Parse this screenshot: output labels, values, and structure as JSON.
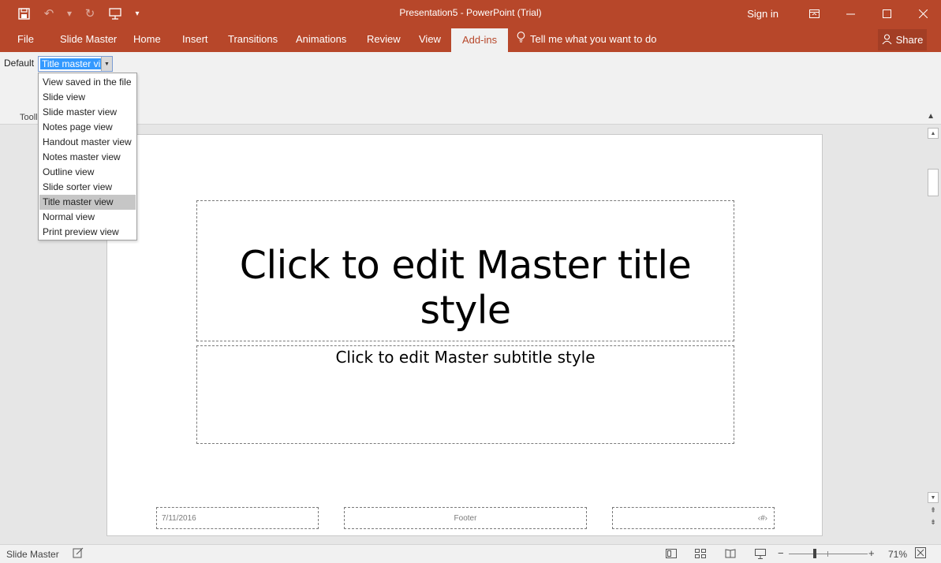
{
  "window": {
    "title": "Presentation5 - PowerPoint (Trial)",
    "sign_in": "Sign in",
    "share": "Share"
  },
  "qat": {
    "save_icon": "save-icon",
    "undo_icon": "undo-icon",
    "redo_icon": "redo-icon",
    "present_icon": "start-from-beginning-icon",
    "customize_icon": "customize-qat-icon"
  },
  "tabs": [
    {
      "label": "File"
    },
    {
      "label": "Slide Master"
    },
    {
      "label": "Home"
    },
    {
      "label": "Insert"
    },
    {
      "label": "Transitions"
    },
    {
      "label": "Animations"
    },
    {
      "label": "Review"
    },
    {
      "label": "View"
    },
    {
      "label": "Add-ins"
    }
  ],
  "active_tab": "Add-ins",
  "tell_me": "Tell me what you want to do",
  "ribbon": {
    "default_label": "Default",
    "combo_value": "Title master vi",
    "group_label": "Tooll"
  },
  "dropdown": {
    "items": [
      "View saved in the file",
      "Slide view",
      "Slide master view",
      "Notes page view",
      "Handout master view",
      "Notes master view",
      "Outline view",
      "Slide sorter view",
      "Title master view",
      "Normal view",
      "Print preview view"
    ],
    "selected": "Title master view"
  },
  "slide": {
    "title": "Click to edit Master title style",
    "subtitle": "Click to edit Master subtitle style",
    "date": "7/11/2016",
    "footer": "Footer",
    "number": "‹#›"
  },
  "status": {
    "mode": "Slide Master",
    "zoom_pct": "71%",
    "zoom_minus": "−",
    "zoom_plus": "+"
  },
  "colors": {
    "accent": "#b7472a",
    "selection": "#3399ff"
  }
}
